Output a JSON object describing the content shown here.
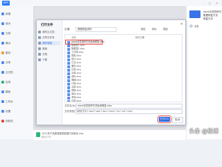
{
  "app": {
    "tab_title": "WPS"
  },
  "left_nav": [
    {
      "label": "新建",
      "color": "blue"
    },
    {
      "label": "首页",
      "color": "blue"
    },
    {
      "label": "文档",
      "color": "blue"
    },
    {
      "label": "最近",
      "color": "blue"
    },
    {
      "label": "星标",
      "color": "orange"
    },
    {
      "label": "共享",
      "color": "blue"
    },
    {
      "label": "云文档",
      "color": "blue"
    },
    {
      "label": "应用",
      "color": "green"
    },
    {
      "label": "模板",
      "color": "blue"
    },
    {
      "label": "工作台",
      "color": "blue"
    },
    {
      "label": "设置",
      "color": "blue"
    },
    {
      "label": "回收站",
      "color": "red"
    }
  ],
  "right_panel": {
    "line1": "excel文件损坏打开",
    "line2": "数据恢复方法",
    "line3": "修复方法",
    "small_label": "消息"
  },
  "dialog": {
    "title": "打开文件",
    "close_glyph": "✕",
    "sidebar": [
      {
        "label": "我的云文档",
        "active": false
      },
      {
        "label": "共享文件夹",
        "active": false
      },
      {
        "label": "我的电脑",
        "active": true
      },
      {
        "label": "桌面",
        "active": false
      },
      {
        "label": "文档",
        "active": false
      },
      {
        "label": "下载",
        "active": false
      }
    ],
    "location_label": "位置:",
    "location_value": "数据恢复资料",
    "tools": [
      "类型",
      "排序",
      "视图"
    ],
    "columns": [
      "名称",
      "修改日期"
    ],
    "files": [
      {
        "name": "excel文件损坏打开乱码修复.xlsx",
        "date": "",
        "selected": true
      },
      {
        "name": "数据表1.xlsx",
        "date": ""
      },
      {
        "name": "数据表2.xlsx",
        "date": ""
      },
      {
        "name": "工作簿.xlsx",
        "date": ""
      },
      {
        "name": "报表.xlsx",
        "date": ""
      },
      {
        "name": "统计.xlsx",
        "date": ""
      },
      {
        "name": "汇总.xlsx",
        "date": ""
      },
      {
        "name": "备份.xlsx",
        "date": ""
      },
      {
        "name": "记录.xlsx",
        "date": ""
      },
      {
        "name": "清单.xlsx",
        "date": ""
      },
      {
        "name": "资料.xlsx",
        "date": ""
      },
      {
        "name": "明细.xlsx",
        "date": ""
      },
      {
        "name": "计划.xlsx",
        "date": ""
      },
      {
        "name": "名单.xlsx",
        "date": ""
      },
      {
        "name": "预算.xlsx",
        "date": ""
      },
      {
        "name": "库存.xlsx",
        "date": ""
      },
      {
        "name": "考勤.xlsx",
        "date": ""
      },
      {
        "name": "目录.xlsx",
        "date": ""
      }
    ],
    "filename_label": "文件名(N):",
    "filename_value": "excel文件损坏打开乱码修复.xlsx",
    "filetype_label": "文件类型(T):",
    "filetype_value": "常用文件(*.wps;*.wpt;*.doc;*.docx;*.et;*.xls;*.xlsx)",
    "open_button": "打开(O)",
    "cancel_button": "取消"
  },
  "bottom": {
    "line1": "2021年产品数据报表数据产品报告.xlsx",
    "line2": "最近打开"
  },
  "watermark": "头条 @极速"
}
